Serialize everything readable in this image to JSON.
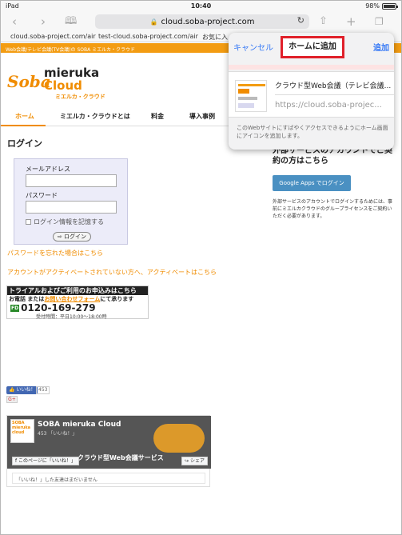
{
  "status_bar": {
    "carrier": "iPad",
    "time": "10:40",
    "battery": "98%",
    "battery_level": 0.98
  },
  "browser": {
    "url": "cloud.soba-project.com",
    "bookmarks": [
      "cloud.soba-project.com/air",
      "test-cloud.soba-project.com/air",
      "お気に入"
    ]
  },
  "site": {
    "top_bar_text": "Web会議/テレビ会議(TV会議)の SOBA ミエルカ・クラウド",
    "logo": {
      "soba": "Soba",
      "mieruka": "mieruka",
      "cloud": "Cloud",
      "kana": "ミエルカ・クラウド"
    },
    "nav": [
      {
        "label": "ホーム",
        "active": true
      },
      {
        "label": "ミエルカ・クラウドとは"
      },
      {
        "label": "料金"
      },
      {
        "label": "導入事例"
      }
    ],
    "login": {
      "title": "ログイン",
      "email_label": "メールアドレス",
      "password_label": "パスワード",
      "remember_label": "ログイン情報を記憶する",
      "button_label": "ログイン"
    },
    "forgot_password": "パスワードを忘れた場合はこちら",
    "activate_link": "アカウントがアクティベートされていない方へ、アクティベートはこちら",
    "trial": {
      "heading": "トライアルおよびご利用のお申込みはこちら",
      "phone_prefix": "お電話 または",
      "phone_link": "お問い合わせフォーム",
      "phone_suffix": "にて承ります",
      "free_dial": "FD",
      "number": "0120-169-279",
      "hours": "受付時間：平日10:00～18:00時"
    },
    "social": {
      "like_button": "いいね！",
      "like_count": "453",
      "gplus": "G+"
    },
    "facebook": {
      "page_name": "SOBA mieruka Cloud",
      "page_likes": "453 「いいね！」",
      "avatar_text": "SOBA mieruka cloud",
      "tagline": "クラウド型Web会議サービス",
      "like_page_button": "このページに「いいね！」",
      "share_button": "シェア",
      "friends_note": "「いいね！」した友達はまだいません"
    },
    "external": {
      "heading": "外部サービスのアカウントでご契約の方はこちら",
      "google_button": "Google Apps でログイン",
      "note": "外部サービスのアカウントでログインするためには、事前にミエルカクラウドのグループライセンスをご契約いただく必要があります。"
    }
  },
  "popover": {
    "cancel_label": "キャンセル",
    "title": "ホームに追加",
    "add_label": "追加",
    "site_name": "クラウド型Web会議（テレビ会議...",
    "site_url": "https://cloud.soba-projec...",
    "note": "このWebサイトにすばやくアクセスできるようにホーム画面にアイコンを追加します。"
  },
  "colors": {
    "accent": "#f08c00",
    "ios_blue": "#3478f6",
    "highlight_red": "#e0202a"
  }
}
